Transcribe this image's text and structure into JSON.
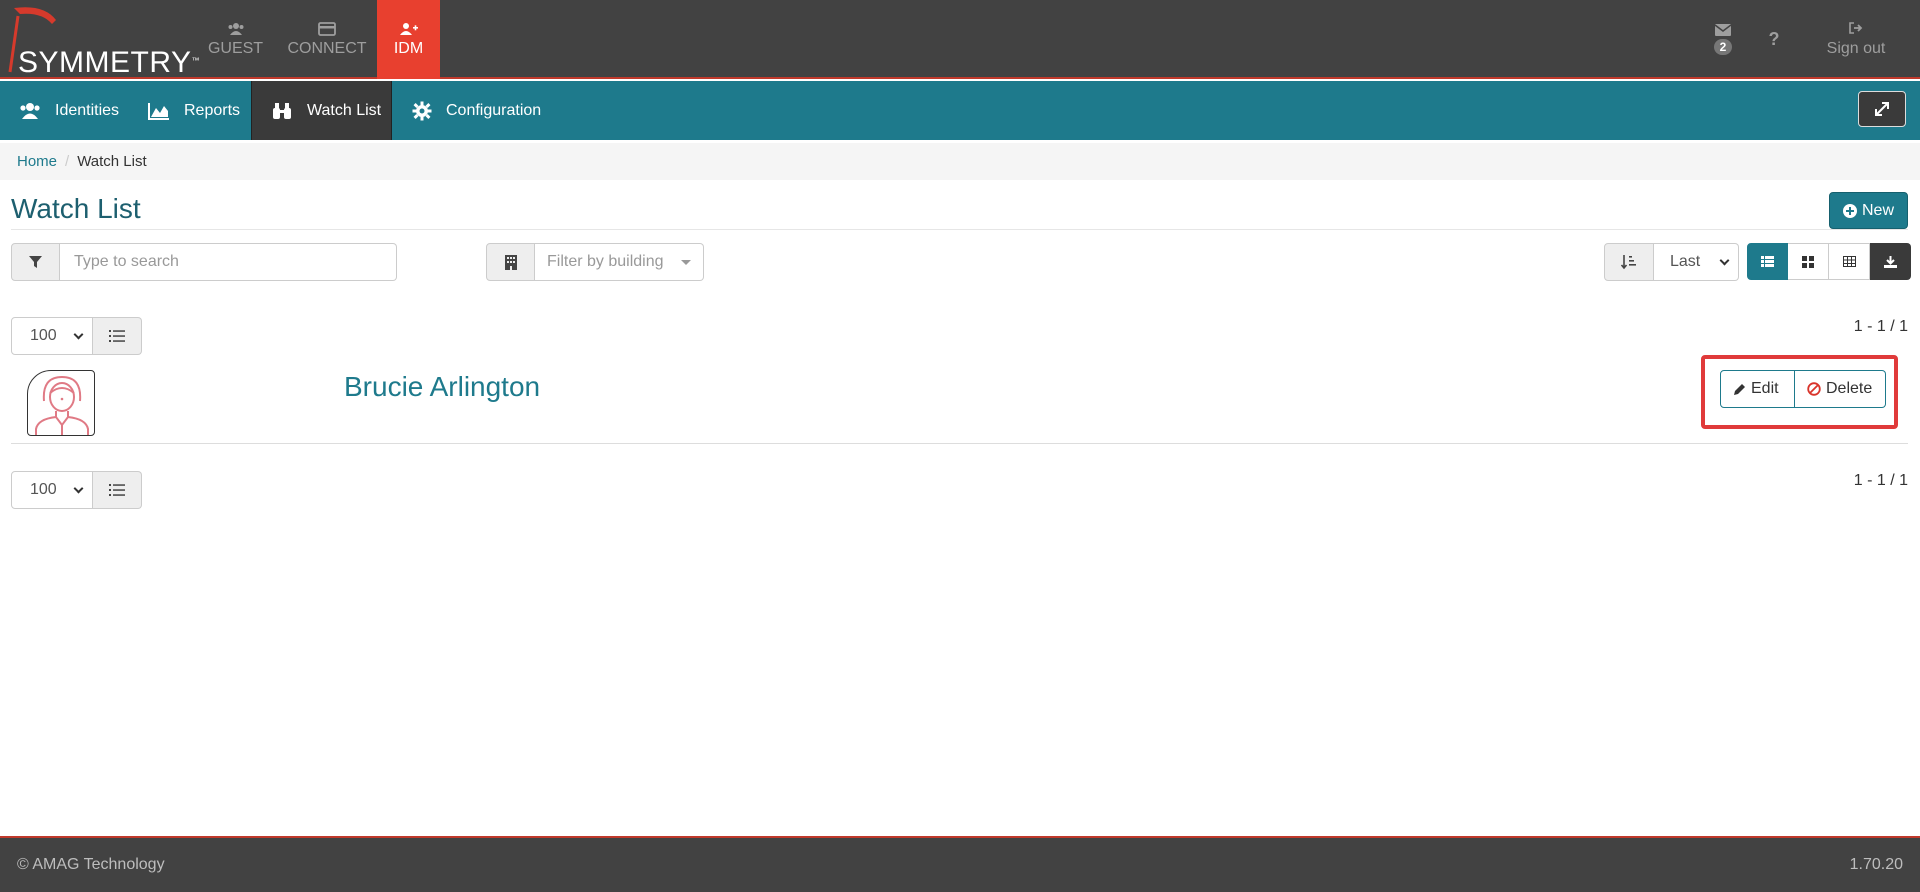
{
  "brand": {
    "logo_text": "SYMMETRY",
    "trademark": "™"
  },
  "app_nav": [
    {
      "label": "GUEST",
      "icon": "users-icon"
    },
    {
      "label": "CONNECT",
      "icon": "card-icon"
    },
    {
      "label": "IDM",
      "icon": "user-plus-icon",
      "active": true
    }
  ],
  "top_right": {
    "mail_count": "2",
    "help": "?",
    "signout_label": "Sign out"
  },
  "sub_nav": [
    {
      "label": "Identities",
      "icon": "users-icon"
    },
    {
      "label": "Reports",
      "icon": "area-chart-icon"
    },
    {
      "label": "Watch List",
      "icon": "binoculars-icon",
      "active": true
    },
    {
      "label": "Configuration",
      "icon": "gear-icon"
    }
  ],
  "breadcrumb": {
    "home": "Home",
    "current": "Watch List"
  },
  "page": {
    "title": "Watch List",
    "new_label": "New"
  },
  "filters": {
    "search_placeholder": "Type to search",
    "building_placeholder": "Filter by building",
    "sort_value": "Last"
  },
  "pager": {
    "page_size": "100",
    "count": "1 - 1 / 1"
  },
  "results": [
    {
      "name": "Brucie Arlington",
      "edit_label": "Edit",
      "delete_label": "Delete"
    }
  ],
  "footer": {
    "copyright": "© AMAG Technology",
    "version": "1.70.20"
  },
  "colors": {
    "accent": "#1e7a8c",
    "active_app": "#e8402f",
    "highlight": "#e03a3a",
    "dark": "#424242"
  }
}
